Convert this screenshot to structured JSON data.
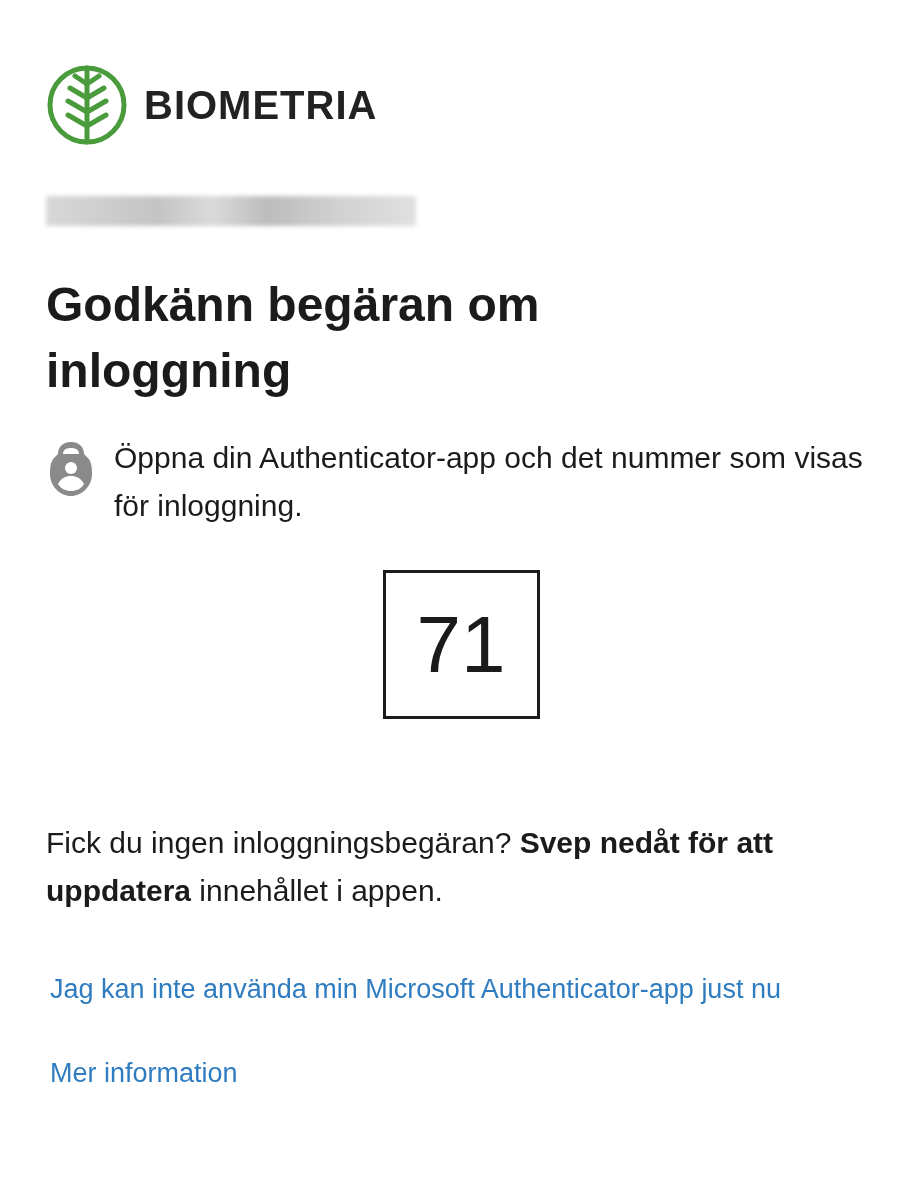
{
  "brand": {
    "name": "BIOMETRIA"
  },
  "heading": "Godkänn begäran om inloggning",
  "instruction": "Öppna din Authenticator-app och det nummer som visas för inloggning.",
  "number": "71",
  "help_text": "Fick du ingen inloggningsbegäran? **Svep nedåt för att uppdatera** innehållet i appen.",
  "links": [
    "Jag kan inte använda min Microsoft Authenticator-app just nu",
    "Mer information"
  ]
}
